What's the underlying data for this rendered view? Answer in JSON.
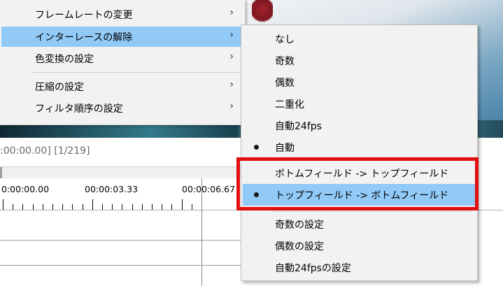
{
  "status": {
    "time_frame": ":00:00.00] [1/219]"
  },
  "timeline": {
    "ruler_labels": [
      "0:00:00.00",
      "00:00:03.33",
      "00:00:06.67"
    ]
  },
  "menu": {
    "items": [
      {
        "label": "フレームレートの変更",
        "arrow": "›"
      },
      {
        "label": "インターレースの解除",
        "arrow": "›",
        "highlighted": true
      },
      {
        "label": "色変換の設定",
        "arrow": "›"
      },
      {
        "label": "圧縮の設定",
        "arrow": "›"
      },
      {
        "label": "フィルタ順序の設定",
        "arrow": "›"
      }
    ]
  },
  "submenu": {
    "items": [
      {
        "label": "なし"
      },
      {
        "label": "奇数"
      },
      {
        "label": "偶数"
      },
      {
        "label": "二重化"
      },
      {
        "label": "自動24fps"
      },
      {
        "label": "自動",
        "checked": true
      },
      {
        "label": "ボトムフィールド -> トップフィールド"
      },
      {
        "label": "トップフィールド -> ボトムフィールド",
        "checked": true,
        "highlighted": true
      },
      {
        "label": "奇数の設定"
      },
      {
        "label": "偶数の設定"
      },
      {
        "label": "自動24fpsの設定"
      }
    ]
  },
  "colors": {
    "highlight": "#91c9f7",
    "annotation_box": "#e01010",
    "menu_bg": "#f2f2f2"
  }
}
